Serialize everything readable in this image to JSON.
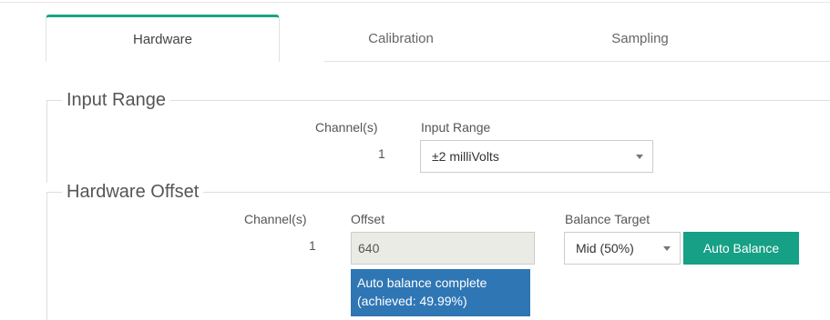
{
  "tabs": [
    "Hardware",
    "Calibration",
    "Sampling"
  ],
  "active_tab": "Hardware",
  "input_range": {
    "legend": "Input Range",
    "col_channels": "Channel(s)",
    "col_range": "Input Range",
    "channel": "1",
    "range_value": "±2 milliVolts"
  },
  "hardware_offset": {
    "legend": "Hardware Offset",
    "col_channels": "Channel(s)",
    "col_offset": "Offset",
    "col_balance": "Balance Target",
    "channel": "1",
    "offset_value": "640",
    "balance_value": "Mid (50%)",
    "auto_balance_label": "Auto Balance",
    "status_line1": "Auto balance complete",
    "status_line2": "(achieved: 49.99%)"
  },
  "colors": {
    "accent": "#16a085",
    "status": "#2f76b5"
  }
}
